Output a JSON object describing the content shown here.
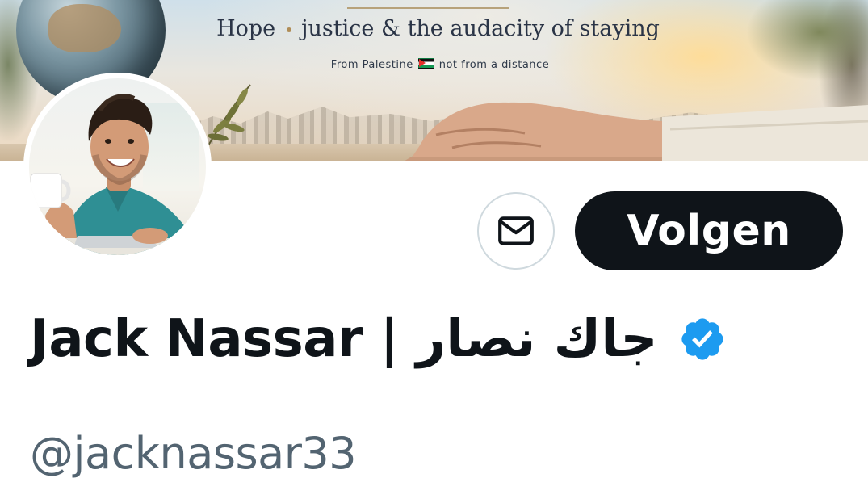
{
  "banner": {
    "title_hope": "Hope",
    "title_rest": "justice & the audacity of staying",
    "subtitle_left": "From Palestine",
    "subtitle_right": "not from a distance"
  },
  "profile": {
    "display_name": "Jack Nassar | جاك نصار",
    "handle": "@jacknassar33",
    "verified": true
  },
  "actions": {
    "message_icon": "envelope-icon",
    "follow_label": "Volgen"
  },
  "colors": {
    "text_primary": "#0f1419",
    "text_secondary": "#536471",
    "follow_bg": "#0f1419",
    "verified_blue": "#1d9bf0",
    "border": "#cfd9de"
  }
}
